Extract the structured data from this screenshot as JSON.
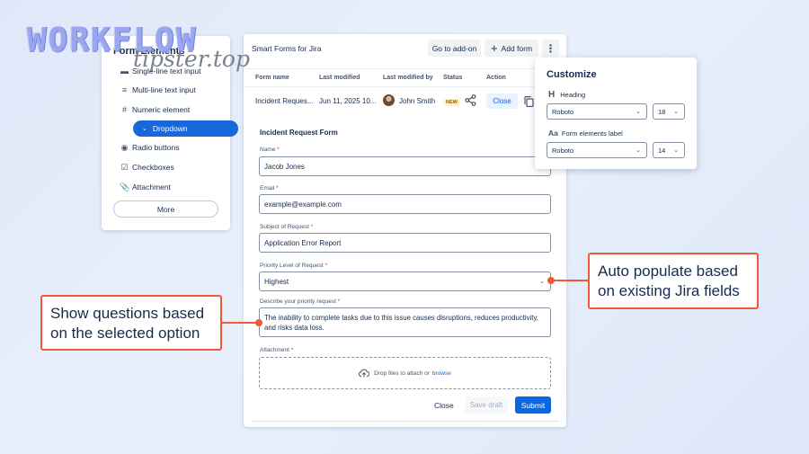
{
  "watermark": {
    "line1": "WORKFLOW",
    "line2": "tipster.top"
  },
  "form_elements": {
    "title": "Form Elements",
    "items": [
      {
        "icon": "single-line-icon",
        "label": "Single-line text input"
      },
      {
        "icon": "multi-line-icon",
        "label": "Multi-line text input"
      },
      {
        "icon": "hash-icon",
        "label": "Numeric element"
      },
      {
        "icon": "chevron-down-icon",
        "label": "Dropdown",
        "selected": true
      },
      {
        "icon": "radio-icon",
        "label": "Radio buttons"
      },
      {
        "icon": "checkbox-icon",
        "label": "Checkboxes"
      },
      {
        "icon": "paperclip-icon",
        "label": "Attachment"
      }
    ],
    "more_label": "More"
  },
  "main": {
    "app_title": "Smart Forms for Jira",
    "toolbar": {
      "go_to_addon": "Go to add-on",
      "add_form": "Add form"
    },
    "table": {
      "headers": [
        "Form name",
        "Last modified",
        "Last modified by",
        "Status",
        "Action"
      ],
      "row": {
        "form_name": "Incident Reques...",
        "last_modified": "Jun 11, 2025 10...",
        "modified_by": "John Smith",
        "status_badge": "NEW",
        "action_label": "Close"
      }
    },
    "form": {
      "title": "Incident Request Form",
      "fields": {
        "name": {
          "label": "Name",
          "required": "*",
          "value": "Jacob Jones"
        },
        "email": {
          "label": "Email",
          "required": "*",
          "value": "example@example.com"
        },
        "subject": {
          "label": "Subject of Request",
          "required": "*",
          "value": "Application Error Report"
        },
        "priority": {
          "label": "Priority Level of Request",
          "required": "*",
          "value": "Highest"
        },
        "describe": {
          "label": "Describe your priority request",
          "required": "*",
          "value": "The inability to complete tasks due to this issue causes disruptions, reduces productivity, and risks data loss."
        },
        "attachment": {
          "label": "Attachment",
          "required": "*",
          "drop_text": "Drop files to attach or",
          "browse": "browse"
        }
      },
      "footer": {
        "close": "Close",
        "save_draft": "Save draft",
        "submit": "Submit"
      }
    }
  },
  "customize": {
    "title": "Customize",
    "heading": {
      "label": "Heading",
      "font": "Roboto",
      "size": "18"
    },
    "form_elements_label": {
      "label": "Form elements label",
      "font": "Roboto",
      "size": "14"
    }
  },
  "callouts": {
    "left": "Show questions based on the selected option",
    "right": "Auto populate based on existing Jira fields"
  },
  "colors": {
    "accent": "#1868db",
    "callout": "#ef5b3a",
    "new_badge": "#a05a00"
  }
}
